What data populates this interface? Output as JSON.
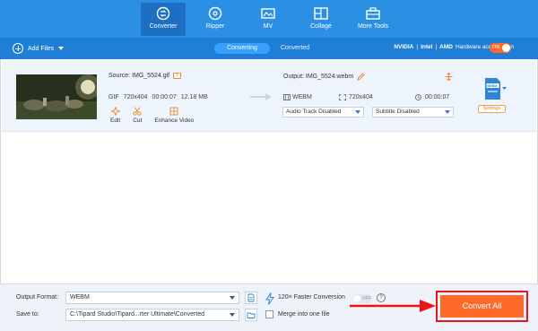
{
  "nav": {
    "tabs": [
      {
        "label": "Converter",
        "icon": "converter-icon",
        "active": true
      },
      {
        "label": "Ripper",
        "icon": "ripper-icon",
        "active": false
      },
      {
        "label": "MV",
        "icon": "mv-icon",
        "active": false
      },
      {
        "label": "Collage",
        "icon": "collage-icon",
        "active": false
      },
      {
        "label": "More Tools",
        "icon": "toolbox-icon",
        "active": false
      }
    ]
  },
  "toolbar": {
    "add_files": "Add Files",
    "segments": [
      "Converting",
      "Converted"
    ],
    "hw_nvidia": "NVIDIA",
    "hw_intel": "Intel",
    "hw_amd": "AMD",
    "hw_label": "Hardware acceleration",
    "hw_toggle": "ON"
  },
  "file": {
    "source": "Source: IMG_5524.gif",
    "src_format": "GIF",
    "src_resolution": "720x404",
    "src_duration": "00:00:07",
    "src_size": "12.18 MB",
    "actions": [
      "Edit",
      "Cut",
      "Enhance Video"
    ],
    "output": "Output: IMG_5524.webm",
    "out_format": "WEBM",
    "out_resolution": "720x404",
    "out_duration": "00:00:07",
    "audio_track": "Audio Track Disabled",
    "subtitle": "Subtitle Disabled",
    "format_badge": "WEBM",
    "settings": "Settings"
  },
  "bottom": {
    "output_format_label": "Output Format:",
    "output_format_value": "WEBM",
    "save_to_label": "Save to:",
    "save_to_value": "C:\\Tipard Studio\\Tipard...rter Ultimate\\Converted",
    "faster_conversion": "120× Faster Conversion",
    "faster_toggle": "OFF",
    "help": "?",
    "merge": "Merge into one file",
    "convert_all": "Convert All"
  },
  "colors": {
    "nav_bg": "#2b8fe3",
    "toolbar_bg": "#1f7fd6",
    "accent_orange": "#ff6a2b",
    "highlight_red": "#e8141b"
  }
}
